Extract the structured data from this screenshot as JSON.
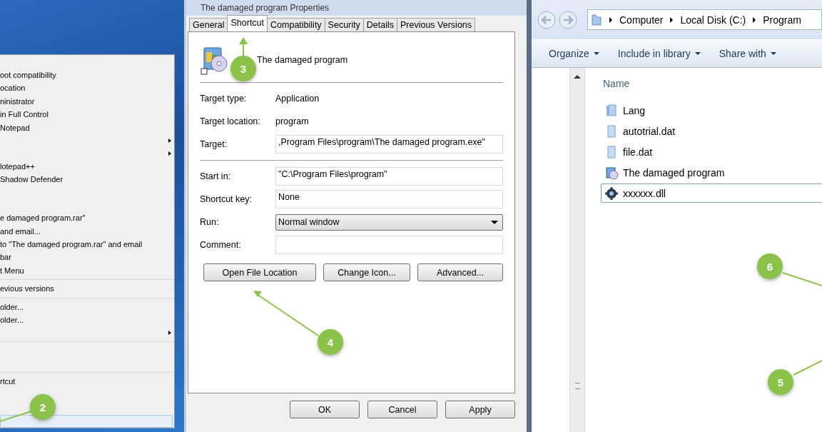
{
  "context_menu": {
    "items": [
      {
        "kind": "item",
        "label": "oot compatibility",
        "submenu": false,
        "highlighted": false
      },
      {
        "kind": "item",
        "label": "ocation",
        "submenu": false,
        "highlighted": false
      },
      {
        "kind": "item",
        "label": "ninistrator",
        "submenu": false,
        "highlighted": false
      },
      {
        "kind": "item",
        "label": "in Full Control",
        "submenu": false,
        "highlighted": false
      },
      {
        "kind": "item",
        "label": "Notepad",
        "submenu": false,
        "highlighted": false
      },
      {
        "kind": "item",
        "submenu": true,
        "highlighted": false
      },
      {
        "kind": "item",
        "submenu": true,
        "highlighted": false
      },
      {
        "kind": "item",
        "label": "lotepad++",
        "submenu": false,
        "highlighted": false
      },
      {
        "kind": "item",
        "label": "Shadow Defender",
        "submenu": false,
        "highlighted": false
      },
      {
        "kind": "spacer"
      },
      {
        "kind": "spacer"
      },
      {
        "kind": "item",
        "label": "e damaged program.rar\"",
        "submenu": false,
        "highlighted": false
      },
      {
        "kind": "item",
        "label": "and email...",
        "submenu": false,
        "highlighted": false
      },
      {
        "kind": "item",
        "label": "to \"The damaged program.rar\" and email",
        "submenu": false,
        "highlighted": false
      },
      {
        "kind": "item",
        "label": "bar",
        "submenu": false,
        "highlighted": false
      },
      {
        "kind": "item",
        "label": "t Menu",
        "submenu": false,
        "highlighted": false
      },
      {
        "kind": "separator"
      },
      {
        "kind": "item",
        "label": "evious versions",
        "submenu": false,
        "highlighted": false
      },
      {
        "kind": "separator"
      },
      {
        "kind": "item",
        "label": "older...",
        "submenu": false,
        "highlighted": false
      },
      {
        "kind": "item",
        "label": "older...",
        "submenu": false,
        "highlighted": false
      },
      {
        "kind": "item",
        "submenu": true,
        "highlighted": false
      },
      {
        "kind": "separator"
      },
      {
        "kind": "spacer"
      },
      {
        "kind": "spacer"
      },
      {
        "kind": "separator"
      },
      {
        "kind": "item",
        "label": "rtcut",
        "submenu": false,
        "highlighted": false
      },
      {
        "kind": "spacer"
      },
      {
        "kind": "spacer"
      },
      {
        "kind": "item",
        "submenu": false,
        "highlighted": true
      }
    ]
  },
  "properties_dialog": {
    "title": "The damaged program Properties",
    "tabs": [
      {
        "label": "General",
        "selected": false
      },
      {
        "label": "Shortcut",
        "selected": true
      },
      {
        "label": "Compatibility",
        "selected": false
      },
      {
        "label": "Security",
        "selected": false
      },
      {
        "label": "Details",
        "selected": false
      },
      {
        "label": "Previous Versions",
        "selected": false
      }
    ],
    "shortcut_name": "The damaged program",
    "rows": [
      {
        "kind": "info",
        "label": "Target type:",
        "value": "Application"
      },
      {
        "kind": "info",
        "label": "Target location:",
        "value": "program"
      },
      {
        "kind": "field",
        "label": "Target:",
        "value": ",Program Files\\program\\The damaged program.exe\""
      },
      {
        "kind": "divider"
      },
      {
        "kind": "field",
        "label": "Start in:",
        "value": "\"C:\\Program Files\\program\""
      },
      {
        "kind": "field",
        "label": "Shortcut key:",
        "value": "None"
      },
      {
        "kind": "dropdown",
        "label": "Run:",
        "value": "Normal window"
      },
      {
        "kind": "field",
        "label": "Comment:"
      }
    ],
    "actions": [
      "Open File Location",
      "Change Icon...",
      "Advanced..."
    ],
    "buttons": [
      "OK",
      "Cancel",
      "Apply"
    ]
  },
  "explorer": {
    "breadcrumb": [
      "Computer",
      "Local Disk (C:)",
      "Program"
    ],
    "toolbar": [
      "Organize",
      "Include in library",
      "Share with"
    ],
    "column": "Name",
    "files": [
      {
        "kind": "folder",
        "name": "Lang",
        "selected": false
      },
      {
        "kind": "file",
        "name": "autotrial.dat",
        "selected": false
      },
      {
        "kind": "file",
        "name": "file.dat",
        "selected": false
      },
      {
        "kind": "program",
        "name": "The damaged program",
        "selected": false
      },
      {
        "kind": "dll",
        "name": "xxxxxx.dll",
        "selected": true
      }
    ]
  },
  "callouts": [
    {
      "label": "2"
    },
    {
      "label": "3"
    },
    {
      "label": "4"
    },
    {
      "label": "6"
    },
    {
      "label": "5"
    }
  ]
}
